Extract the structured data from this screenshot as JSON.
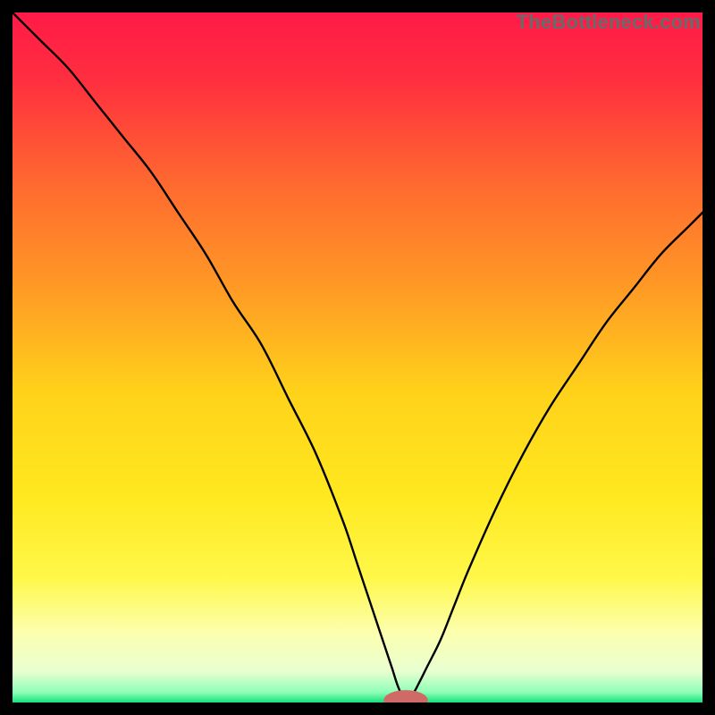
{
  "watermark": "TheBottleneck.com",
  "chart_data": {
    "type": "line",
    "title": "",
    "xlabel": "",
    "ylabel": "",
    "xlim": [
      0,
      100
    ],
    "ylim": [
      0,
      100
    ],
    "grid": false,
    "legend": false,
    "gradient_stops": [
      {
        "offset": 0.0,
        "color": "#ff1a47"
      },
      {
        "offset": 0.1,
        "color": "#ff2f3f"
      },
      {
        "offset": 0.25,
        "color": "#ff6a2f"
      },
      {
        "offset": 0.4,
        "color": "#ff9a25"
      },
      {
        "offset": 0.55,
        "color": "#ffd21a"
      },
      {
        "offset": 0.7,
        "color": "#ffe81f"
      },
      {
        "offset": 0.82,
        "color": "#fff84a"
      },
      {
        "offset": 0.9,
        "color": "#fcffb0"
      },
      {
        "offset": 0.955,
        "color": "#e8ffd0"
      },
      {
        "offset": 0.985,
        "color": "#8effb8"
      },
      {
        "offset": 1.0,
        "color": "#16e07a"
      }
    ],
    "marker": {
      "x": 57,
      "y": 0.3,
      "color": "#d06a66",
      "rx": 3.2,
      "ry": 1.5
    },
    "series": [
      {
        "name": "curve",
        "color": "#000000",
        "x": [
          0,
          4,
          8,
          12,
          16,
          20,
          24,
          28,
          32,
          36,
          40,
          44,
          48,
          50,
          52,
          54,
          55,
          56,
          57,
          58,
          59,
          60,
          62,
          64,
          66,
          70,
          74,
          78,
          82,
          86,
          90,
          94,
          98,
          100
        ],
        "y": [
          100,
          96,
          92,
          87,
          82,
          77,
          71,
          65,
          58,
          52,
          44,
          36,
          26,
          20,
          14,
          8,
          5,
          2,
          0.3,
          1.2,
          3,
          5,
          9,
          14,
          19,
          28,
          36,
          43,
          49,
          55,
          60,
          65,
          69,
          71
        ]
      }
    ]
  }
}
